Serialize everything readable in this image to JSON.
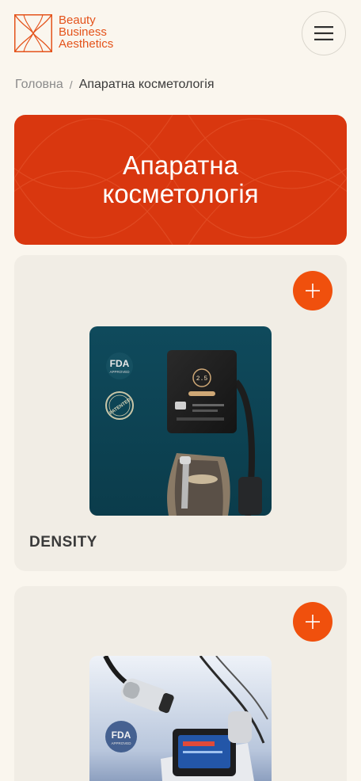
{
  "brand": {
    "line1": "Beauty",
    "line2": "Business",
    "line3": "Aesthetics",
    "color": "#e4531b"
  },
  "header": {
    "menu_icon": "hamburger-icon"
  },
  "breadcrumb": {
    "home": "Головна",
    "separator": "/",
    "current": "Апаратна косметологія"
  },
  "hero": {
    "title": "Апаратна косметологія",
    "background": "#d9370f"
  },
  "products": [
    {
      "title": "DENSITY",
      "badges": [
        "FDA APPROVED",
        "PATENTED"
      ],
      "add_icon": "plus-icon"
    },
    {
      "title": "",
      "badges": [
        "FDA APPROVED"
      ],
      "add_icon": "plus-icon"
    }
  ],
  "colors": {
    "accent": "#f0500d",
    "page_bg": "#faf6ee",
    "card_bg": "#f1ede5"
  }
}
